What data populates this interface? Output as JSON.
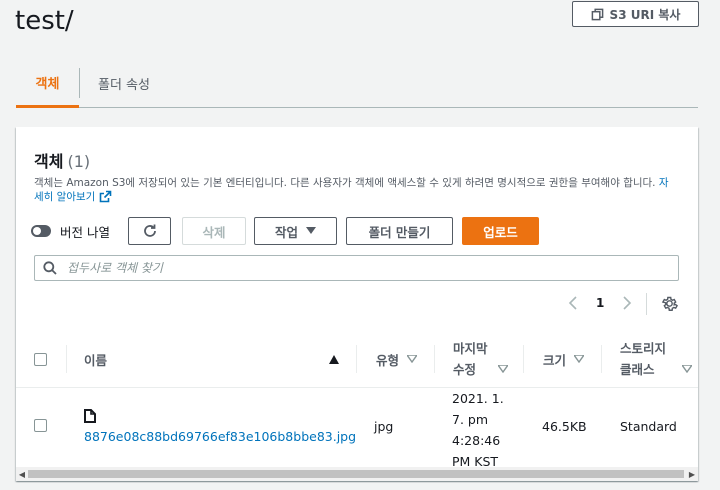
{
  "header": {
    "title": "test/",
    "copy_uri_label": "S3 URI 복사"
  },
  "tabs": [
    {
      "label": "객체"
    },
    {
      "label": "폴더 속성"
    }
  ],
  "panel": {
    "title": "객체",
    "count": "(1)",
    "description": "객체는 Amazon S3에 저장되어 있는 기본 엔터티입니다. 다른 사용자가 객체에 액세스할 수 있게 하려면 명시적으로 권한을 부여해야 합니다.",
    "learn_more": "자세히 알아보기"
  },
  "toolbar": {
    "versions_label": "버전 나열",
    "delete_label": "삭제",
    "actions_label": "작업",
    "create_folder_label": "폴더 만들기",
    "upload_label": "업로드"
  },
  "search": {
    "placeholder": "접두사로 객체 찾기"
  },
  "pagination": {
    "page": "1"
  },
  "table": {
    "headers": {
      "name": "이름",
      "type": "유형",
      "modified": "마지막 수정",
      "size": "크기",
      "storage": "스토리지 클래스"
    },
    "rows": [
      {
        "name": "8876e08c88bd69766ef83e106b8bbe83.jpg",
        "type": "jpg",
        "modified": [
          "2021. 1.",
          "7. pm",
          "4:28:46",
          "PM KST"
        ],
        "size": "46.5KB",
        "storage": "Standard"
      }
    ]
  },
  "colors": {
    "accent": "#ec7211",
    "link": "#0073bb"
  }
}
